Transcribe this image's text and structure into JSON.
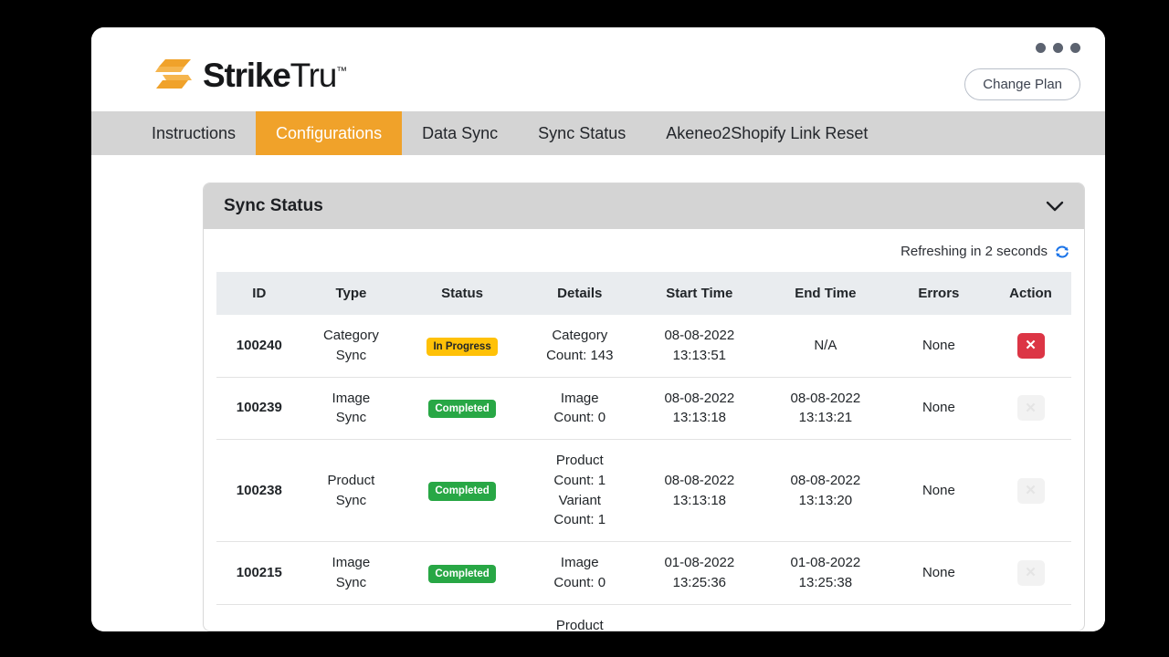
{
  "window": {
    "dots_icon": "window-controls-dots"
  },
  "brand": {
    "logo_icon": "striketru-logo-mark",
    "name_bold": "Strike",
    "name_light": "Tru",
    "trademark": "™",
    "accent_color": "#f0a22a"
  },
  "header": {
    "change_plan_label": "Change Plan"
  },
  "nav": {
    "items": [
      {
        "label": "Instructions",
        "active": false
      },
      {
        "label": "Configurations",
        "active": true
      },
      {
        "label": "Data Sync",
        "active": false
      },
      {
        "label": "Sync Status",
        "active": false
      },
      {
        "label": "Akeneo2Shopify Link Reset",
        "active": false
      }
    ]
  },
  "panel": {
    "title": "Sync Status",
    "collapse_icon": "chevron-down-icon",
    "refresh_text": "Refreshing in 2 seconds",
    "refresh_icon": "refresh-icon",
    "refresh_icon_color": "#1a73e8"
  },
  "table": {
    "columns": [
      "ID",
      "Type",
      "Status",
      "Details",
      "Start Time",
      "End Time",
      "Errors",
      "Action"
    ],
    "rows": [
      {
        "id": "100240",
        "type": "Category Sync",
        "status": "In Progress",
        "status_kind": "progress",
        "details": "Category Count: 143",
        "start_time": "08-08-2022 13:13:51",
        "end_time": "N/A",
        "errors": "None",
        "action_label": "✕",
        "action_enabled": true
      },
      {
        "id": "100239",
        "type": "Image Sync",
        "status": "Completed",
        "status_kind": "completed",
        "details": "Image Count: 0",
        "start_time": "08-08-2022 13:13:18",
        "end_time": "08-08-2022 13:13:21",
        "errors": "None",
        "action_label": "✕",
        "action_enabled": false
      },
      {
        "id": "100238",
        "type": "Product Sync",
        "status": "Completed",
        "status_kind": "completed",
        "details": "Product Count: 1 Variant Count: 1",
        "start_time": "08-08-2022 13:13:18",
        "end_time": "08-08-2022 13:13:20",
        "errors": "None",
        "action_label": "✕",
        "action_enabled": false
      },
      {
        "id": "100215",
        "type": "Image Sync",
        "status": "Completed",
        "status_kind": "completed",
        "details": "Image Count: 0",
        "start_time": "01-08-2022 13:25:36",
        "end_time": "01-08-2022 13:25:38",
        "errors": "None",
        "action_label": "✕",
        "action_enabled": false
      },
      {
        "id": "",
        "type": "",
        "status": "",
        "status_kind": "none",
        "details": "Product",
        "start_time": "",
        "end_time": "",
        "errors": "",
        "action_label": "",
        "action_enabled": false
      }
    ]
  }
}
